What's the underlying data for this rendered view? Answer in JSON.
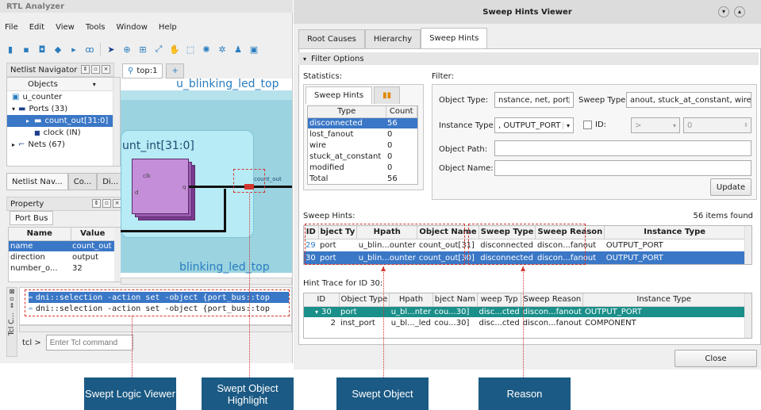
{
  "rtl": {
    "title": "RTL Analyzer",
    "menu": [
      "File",
      "Edit",
      "View",
      "Tools",
      "Window",
      "Help"
    ],
    "netlist_navigator": {
      "title": "Netlist Navigator",
      "column": "Objects",
      "items": [
        "u_counter",
        "Ports (33)",
        "count_out[31:0]",
        "clock (IN)",
        "Nets (67)"
      ],
      "tabs": [
        "Netlist Nav...",
        "Co...",
        "Di..."
      ]
    },
    "property": {
      "title": "Property",
      "tab": "Port Bus",
      "columns": [
        "Name",
        "Value"
      ],
      "rows": [
        {
          "name": "name",
          "value": "count_out"
        },
        {
          "name": "direction",
          "value": "output"
        },
        {
          "name": "number_o...",
          "value": "32"
        }
      ]
    },
    "schematic": {
      "tab": "top:1",
      "add_tab": "+",
      "top_label": "u_blinking_led_top",
      "instance_label": "unt_int[31:0]",
      "bottom_label": "blinking_led_top",
      "pin_clk": "clk",
      "pin_d": "d",
      "pin_q": "q",
      "port_label": "count_out"
    },
    "tcl": {
      "side_label": "Tcl C...",
      "lines": [
        "dni::selection -action set -object {port_bus::top",
        "dni::selection -action set -object {port_bus::top"
      ],
      "prompt": "tcl >",
      "placeholder": "Enter Tcl command"
    }
  },
  "sweep": {
    "title": "Sweep Hints Viewer",
    "tabs": [
      "Root Causes",
      "Hierarchy",
      "Sweep Hints"
    ],
    "filter_options": "Filter Options",
    "statistics_label": "Statistics:",
    "filter_label": "Filter:",
    "stats_tab": "Sweep Hints",
    "stats_columns": [
      "Type",
      "Count"
    ],
    "stats_rows": [
      {
        "type": "disconnected",
        "count": "56"
      },
      {
        "type": "lost_fanout",
        "count": "0"
      },
      {
        "type": "wire",
        "count": "0"
      },
      {
        "type": "stuck_at_constant",
        "count": "0"
      },
      {
        "type": "modified",
        "count": "0"
      },
      {
        "type": "Total",
        "count": "56"
      }
    ],
    "object_type_label": "Object Type:",
    "object_type_value": "nstance, net, port",
    "sweep_type_label": "Sweep Type:",
    "sweep_type_value": "anout, stuck_at_constant, wire",
    "instance_type_label": "Instance Type:",
    "instance_type_value": ", OUTPUT_PORT",
    "id_label": "ID:",
    "id_op": ">",
    "id_value": "0",
    "object_path_label": "Object Path:",
    "object_name_label": "Object Name:",
    "update": "Update",
    "hints_label": "Sweep Hints:",
    "items_found": "56 items found",
    "hints_columns": [
      "ID",
      "bject Ty",
      "Hpath",
      "Object Name",
      "Sweep Type",
      "Sweep Reason",
      "Instance Type"
    ],
    "hints_rows": [
      [
        "29",
        "port",
        "u_blin...ounter",
        "count_out[31]",
        "disconnected",
        "discon...fanout",
        "OUTPUT_PORT"
      ],
      [
        "30",
        "port",
        "u_blin...ounter",
        "count_out[30]",
        "disconnected",
        "discon...fanout",
        "OUTPUT_PORT"
      ]
    ],
    "trace_label": "Hint Trace for ID 30:",
    "trace_columns": [
      "ID",
      "Object Type",
      "Hpath",
      "bject Nam",
      "weep Typ",
      "Sweep Reason",
      "Instance Type"
    ],
    "trace_rows": [
      [
        "30",
        "port",
        "u_bl...nter",
        "cou...30]",
        "disc...cted",
        "discon...fanout",
        "OUTPUT_PORT"
      ],
      [
        "2",
        "inst_port",
        "u_bl..._led",
        "cou...30]",
        "disc...cted",
        "discon...fanout",
        "COMPONENT"
      ]
    ],
    "close": "Close"
  },
  "callouts": {
    "logic_viewer": "Swept Logic Viewer",
    "object_highlight": "Swept Object Highlight",
    "swept_object": "Swept Object",
    "reason": "Reason"
  },
  "colors": {
    "selection": "#3a77c6",
    "teal": "#1b8f8a",
    "callout": "#1b5a84",
    "dash": "#d3352e"
  }
}
